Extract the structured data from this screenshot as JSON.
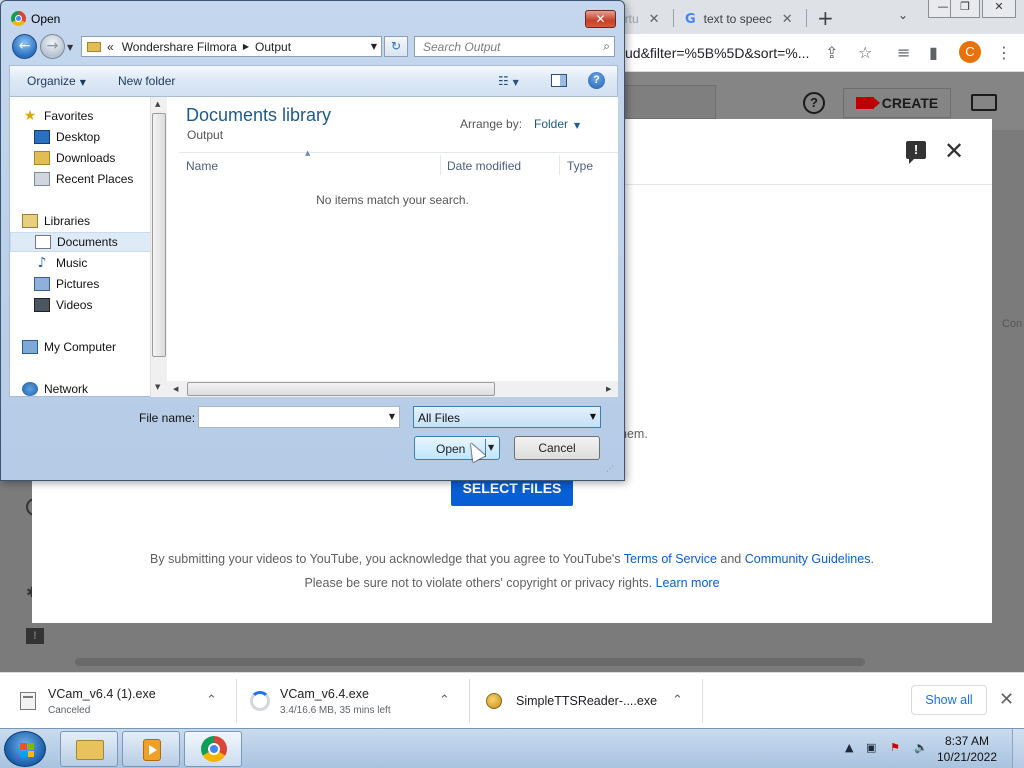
{
  "chrome": {
    "tabs": [
      {
        "title": "irtu",
        "close": "✕"
      },
      {
        "title": "text to speec",
        "close": "✕"
      }
    ],
    "new_tab": "+",
    "url_tail": "ud&filter=%5B%5D&sort=%...",
    "profile_initial": "C",
    "window_controls": {
      "minimize": "—",
      "maximize": "❐",
      "close": "✕"
    }
  },
  "youtube": {
    "create_label": "CREATE",
    "help_glyph": "?",
    "select_files_label": "SELECT FILES",
    "partial_text": "hem.",
    "partial_text_2": "l",
    "side_partial": "Con",
    "disclaimer": {
      "line1_prefix": "By submitting your videos to YouTube, you acknowledge that you agree to YouTube's ",
      "terms_link": "Terms of Service",
      "line1_and": " and ",
      "guidelines_link": "Community Guidelines",
      "line1_suffix": ".",
      "line2_prefix": "Please be sure not to violate others' copyright or privacy rights. ",
      "learn_more_link": "Learn more"
    }
  },
  "downloads": {
    "items": [
      {
        "name": "VCam_v6.4 (1).exe",
        "status": "Canceled"
      },
      {
        "name": "VCam_v6.4.exe",
        "status": "3.4/16.6 MB, 35 mins left"
      },
      {
        "name": "SimpleTTSReader-....exe",
        "status": ""
      }
    ],
    "show_all": "Show all"
  },
  "dialog": {
    "title": "Open",
    "breadcrumb": [
      "Wondershare Filmora",
      "Output"
    ],
    "breadcrumb_prefix": "«",
    "search_placeholder": "Search Output",
    "commands": {
      "organize": "Organize",
      "new_folder": "New folder"
    },
    "nav": {
      "favorites": "Favorites",
      "desktop": "Desktop",
      "downloads": "Downloads",
      "recent_places": "Recent Places",
      "libraries": "Libraries",
      "documents": "Documents",
      "music": "Music",
      "pictures": "Pictures",
      "videos": "Videos",
      "my_computer": "My Computer",
      "network": "Network"
    },
    "library_title": "Documents library",
    "library_subtitle": "Output",
    "arrange_by_label": "Arrange by:",
    "arrange_by_value": "Folder",
    "columns": {
      "name": "Name",
      "date_modified": "Date modified",
      "type": "Type"
    },
    "empty_message": "No items match your search.",
    "file_name_label": "File name:",
    "file_name_value": "",
    "file_type": "All Files",
    "open_button": "Open",
    "cancel_button": "Cancel"
  },
  "taskbar": {
    "time": "8:37 AM",
    "date": "10/21/2022"
  }
}
